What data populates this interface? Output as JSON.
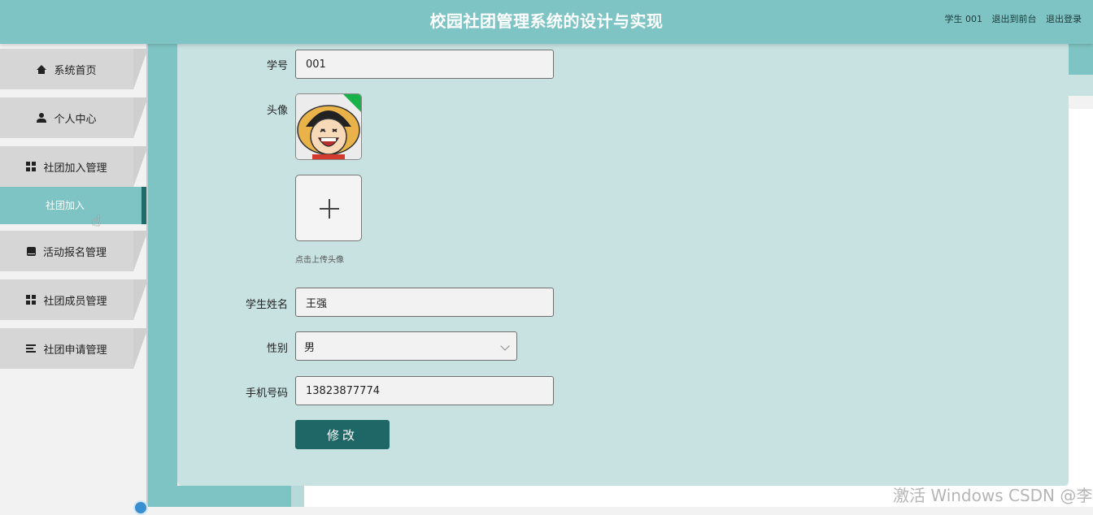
{
  "header": {
    "title": "校园社团管理系统的设计与实现",
    "user": "学生 001",
    "link_front": "退出到前台",
    "link_logout": "退出登录"
  },
  "sidebar": {
    "items": [
      {
        "label": "系统首页",
        "icon": "home-icon"
      },
      {
        "label": "个人中心",
        "icon": "user-icon"
      },
      {
        "label": "社团加入管理",
        "icon": "grid-icon"
      },
      {
        "label": "活动报名管理",
        "icon": "book-icon"
      },
      {
        "label": "社团成员管理",
        "icon": "grid-icon"
      },
      {
        "label": "社团申请管理",
        "icon": "list-icon"
      }
    ],
    "active_sub": "社团加入"
  },
  "form": {
    "student_no_label": "学号",
    "student_no_value": "001",
    "avatar_label": "头像",
    "upload_hint": "点击上传头像",
    "name_label": "学生姓名",
    "name_value": "王强",
    "gender_label": "性别",
    "gender_value": "男",
    "phone_label": "手机号码",
    "phone_value": "13823877774",
    "submit_label": "修改"
  },
  "watermark": "激活 Windows CSDN @李子a",
  "colors": {
    "header_bg": "#7fc4c4",
    "panel_bg": "#c8e1e1",
    "button_bg": "#1f6666",
    "active_border": "#1f6b6b"
  }
}
